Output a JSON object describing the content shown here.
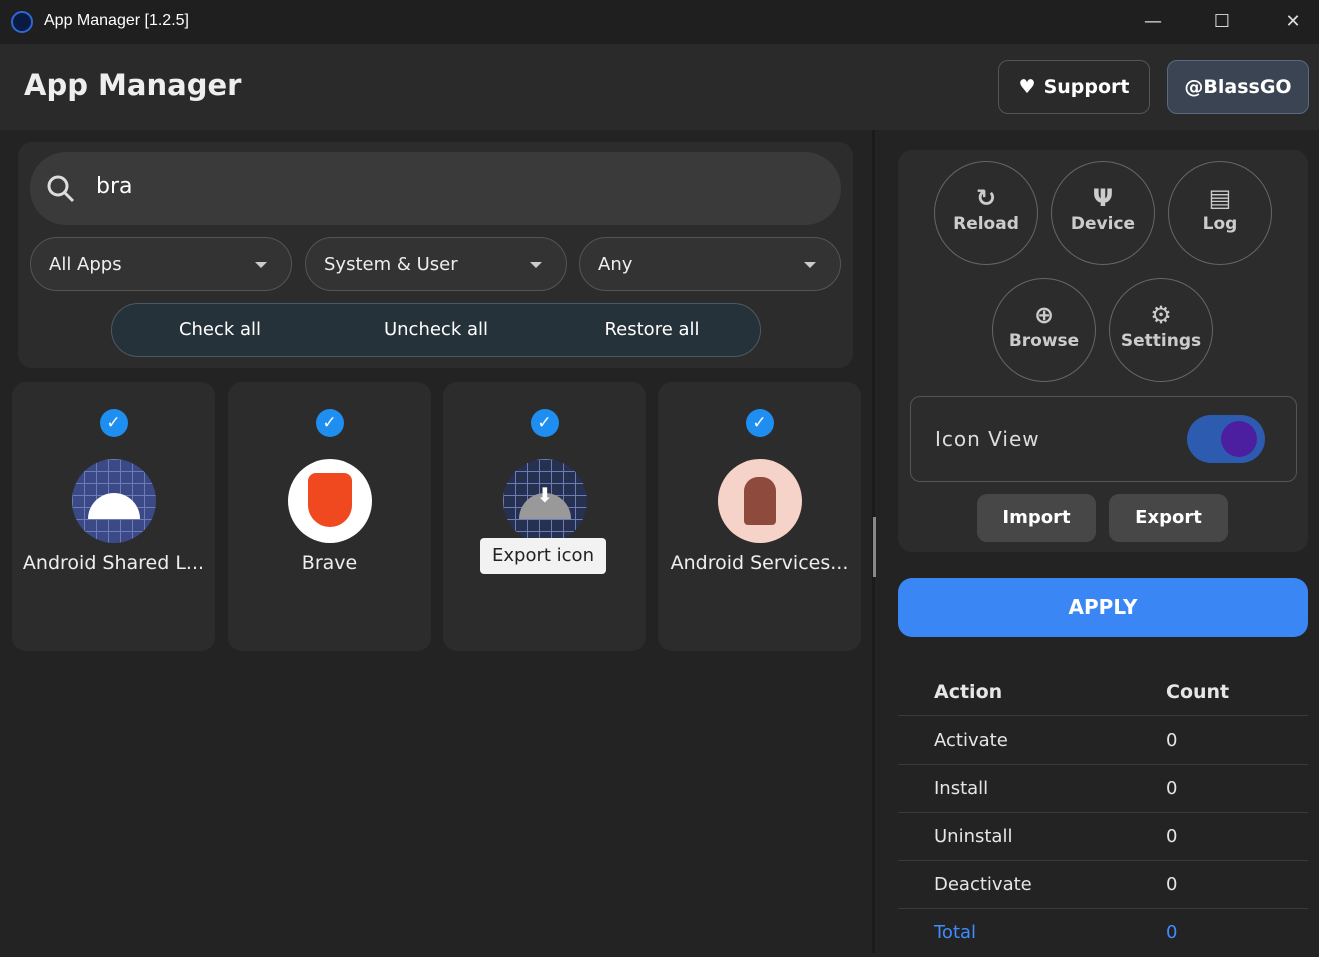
{
  "window": {
    "title": "App Manager [1.2.5]",
    "minimize": "—",
    "maximize": "☐",
    "close": "✕"
  },
  "header": {
    "title": "App Manager",
    "support": "Support",
    "user": "@BlassGO"
  },
  "search": {
    "value": "bra"
  },
  "filters": {
    "type": "All Apps",
    "scope": "System & User",
    "state": "Any"
  },
  "bulk": {
    "check_all": "Check all",
    "uncheck_all": "Uncheck all",
    "restore_all": "Restore all"
  },
  "apps": [
    {
      "name": "Android Shared L...",
      "checked": true
    },
    {
      "name": "Brave",
      "checked": true
    },
    {
      "name": "",
      "checked": true
    },
    {
      "name": "Android Services...",
      "checked": true
    }
  ],
  "tooltip": "Export icon",
  "tools": {
    "reload": "Reload",
    "device": "Device",
    "log": "Log",
    "browse": "Browse",
    "settings": "Settings",
    "icon_view": "Icon View",
    "icon_view_on": true,
    "import": "Import",
    "export": "Export"
  },
  "apply": "APPLY",
  "summary": {
    "headers": [
      "Action",
      "Count"
    ],
    "rows": [
      {
        "action": "Activate",
        "count": "0"
      },
      {
        "action": "Install",
        "count": "0"
      },
      {
        "action": "Uninstall",
        "count": "0"
      },
      {
        "action": "Deactivate",
        "count": "0"
      }
    ],
    "total": {
      "label": "Total",
      "count": "0"
    }
  },
  "colors": {
    "accent": "#3a86f5",
    "check": "#1e8ff0",
    "total": "#3f8cff"
  }
}
